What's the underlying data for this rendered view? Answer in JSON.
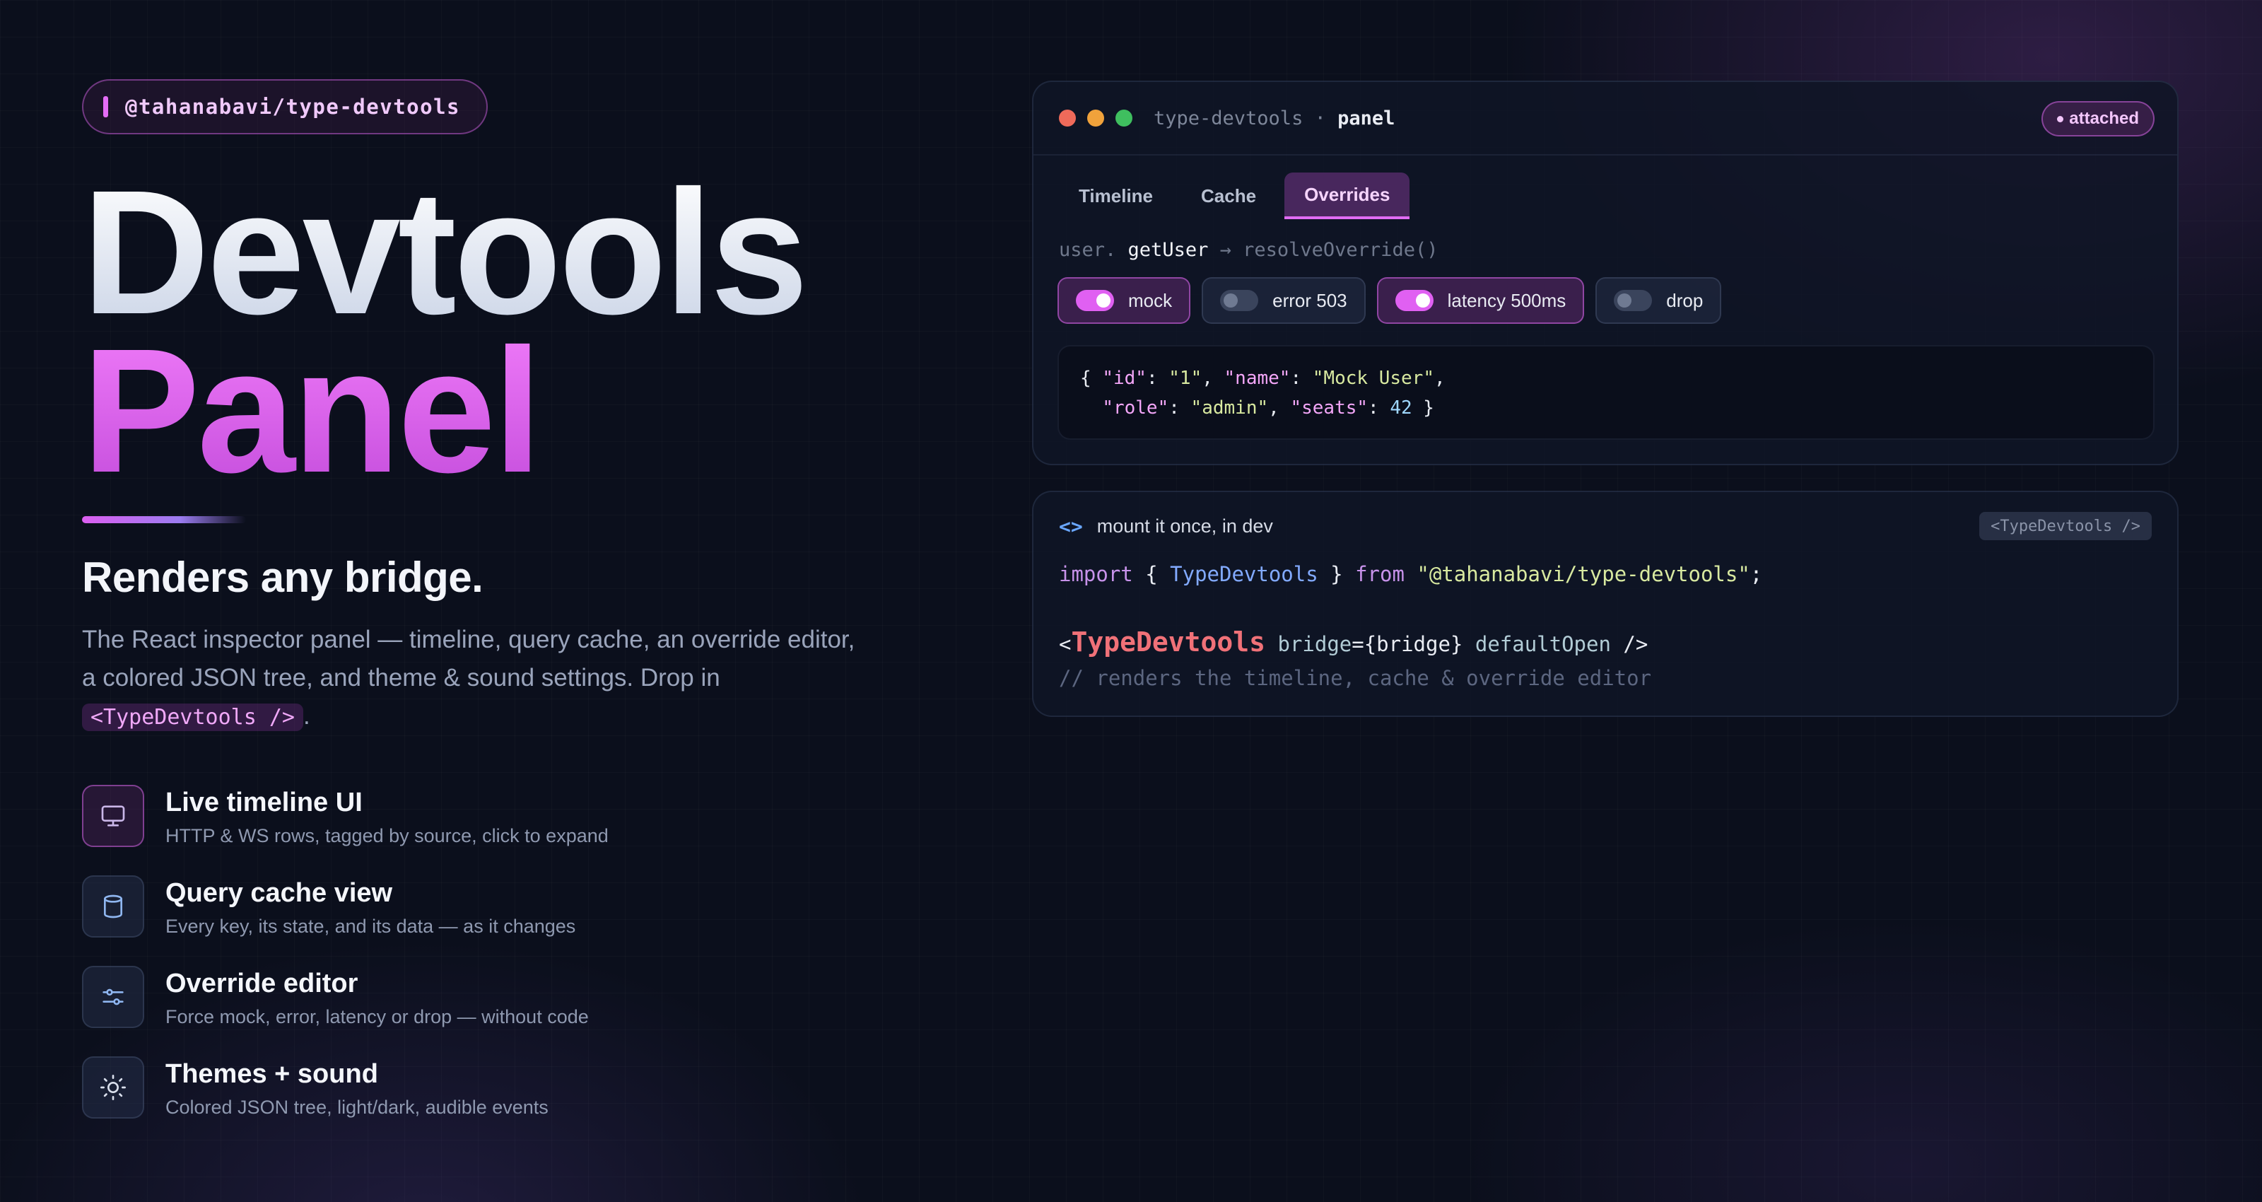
{
  "package_pill": "@tahanabavi/type-devtools",
  "hero": {
    "line1": "Devtools",
    "line2": "Panel"
  },
  "subtitle": "Renders any bridge.",
  "description": {
    "text": "The React inspector panel — timeline, query cache, an override editor, a colored JSON tree, and theme & sound settings. Drop in",
    "code": "<TypeDevtools />",
    "end": "."
  },
  "features": [
    {
      "title": "Live timeline UI",
      "desc": "HTTP & WS rows, tagged by source, click to expand",
      "icon": "monitor-icon"
    },
    {
      "title": "Query cache view",
      "desc": "Every key, its state, and its data — as it changes",
      "icon": "database-icon"
    },
    {
      "title": "Override editor",
      "desc": "Force mock, error, latency or drop — without code",
      "icon": "sliders-icon"
    },
    {
      "title": "Themes + sound",
      "desc": "Colored JSON tree, light/dark, audible events",
      "icon": "sun-icon"
    }
  ],
  "panel": {
    "title_prefix": "type-devtools",
    "separator": "·",
    "title_main": "panel",
    "status": "attached",
    "tabs": [
      "Timeline",
      "Cache",
      "Overrides"
    ],
    "active_tab": "Overrides",
    "resolve": {
      "prefix": "user.",
      "method": "getUser",
      "suffix": "→ resolveOverride()"
    },
    "toggles": [
      {
        "label": "mock",
        "on": true
      },
      {
        "label": "error 503",
        "on": false
      },
      {
        "label": "latency 500ms",
        "on": true
      },
      {
        "label": "drop",
        "on": false
      }
    ],
    "json": {
      "id": "1",
      "name": "Mock User",
      "role": "admin",
      "seats": 42
    }
  },
  "mount_card": {
    "heading": "mount it once, in dev",
    "tag": "<TypeDevtools />",
    "code_import": {
      "kw_import": "import",
      "name": "TypeDevtools",
      "kw_from": "from",
      "module": "\"@tahanabavi/type-devtools\""
    },
    "code_jsx": {
      "tag": "TypeDevtools",
      "attr1": "bridge",
      "val1": "{bridge}",
      "attr2": "defaultOpen"
    },
    "comment": "// renders the timeline, cache & override editor"
  },
  "colors": {
    "accent": "#e36cf5",
    "background": "#0b0f1c",
    "traffic_red": "#ef6a5a",
    "traffic_yellow": "#f0a23b",
    "traffic_green": "#3fbf5f"
  }
}
